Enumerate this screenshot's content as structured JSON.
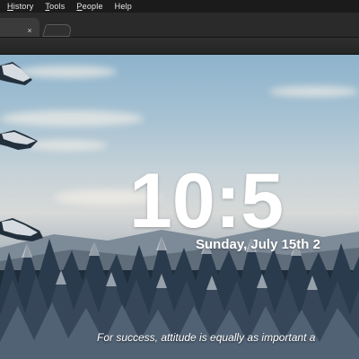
{
  "menu": {
    "items": [
      {
        "label": "History",
        "accel": "H",
        "rest": "istory"
      },
      {
        "label": "Tools",
        "accel": "T",
        "rest": "ools"
      },
      {
        "label": "People",
        "accel": "P",
        "rest": "eople"
      },
      {
        "label": "Help",
        "accel": "",
        "rest": "Help"
      }
    ]
  },
  "tab": {
    "close_glyph": "×"
  },
  "newtab": {
    "clock": "10:5",
    "date": "Sunday, July 15th 2",
    "quote": "For success, attitude is equally as important a"
  },
  "colors": {
    "sky_top": "#8db3cc",
    "forest": "#1f2d3b",
    "chrome": "#2a2a2a"
  },
  "icons": {
    "tab_close": "close-icon",
    "new_tab": "new-tab-icon"
  }
}
